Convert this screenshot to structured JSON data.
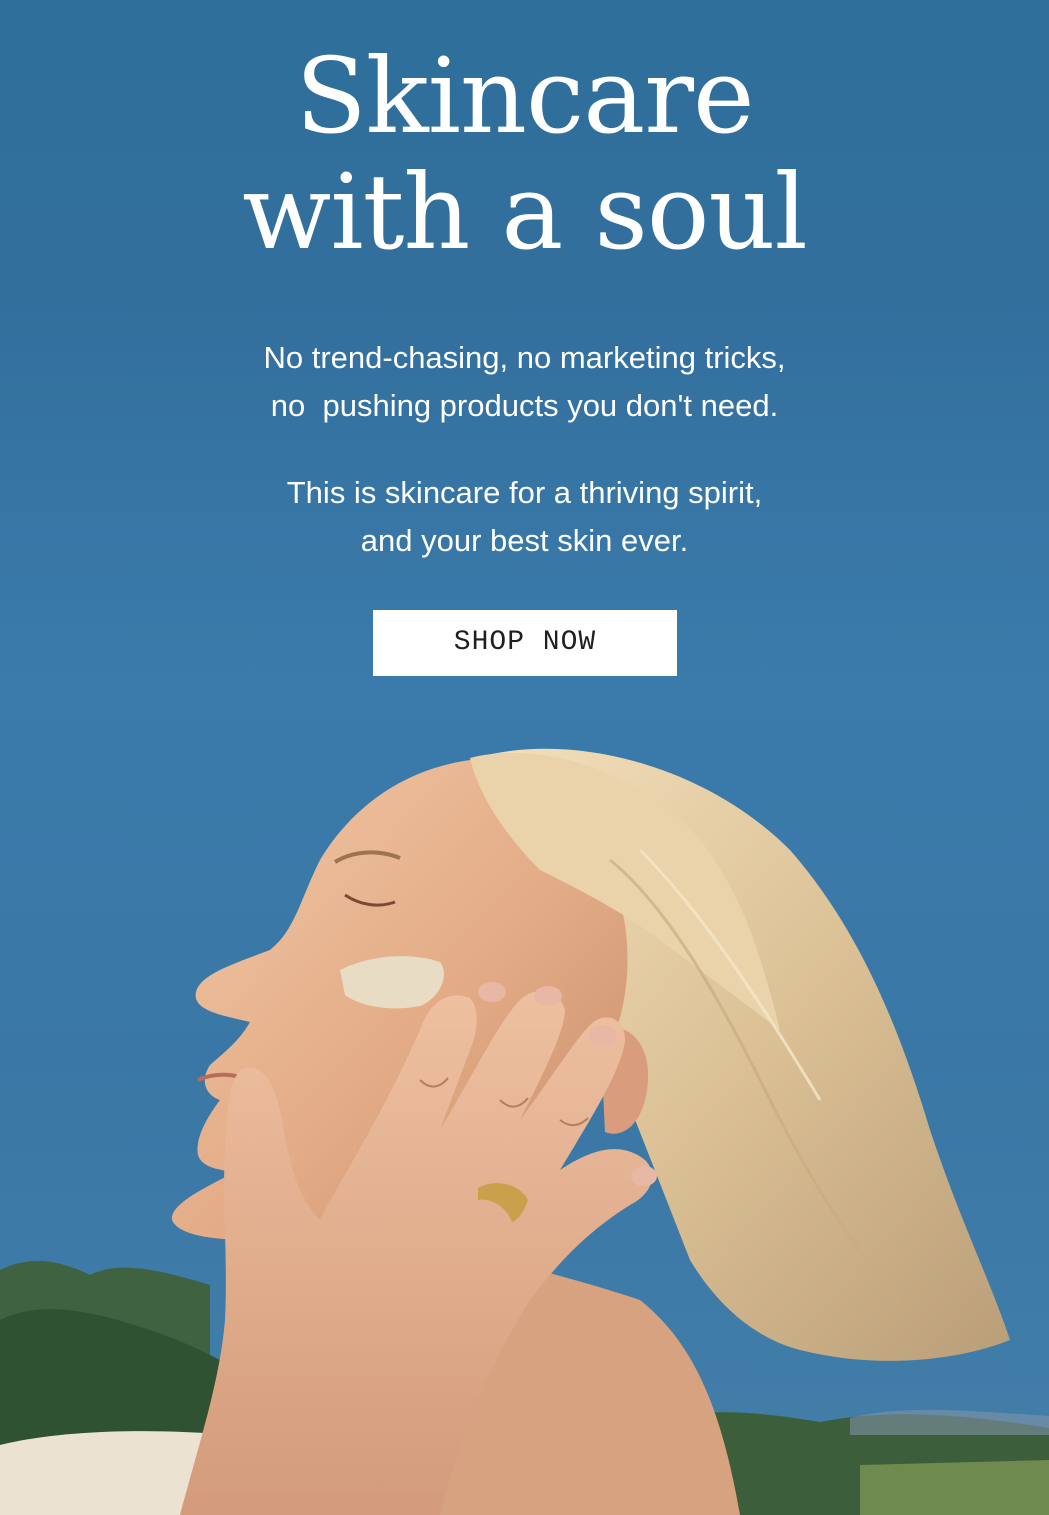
{
  "hero": {
    "headline_line1": "Skincare",
    "headline_line2": "with a soul",
    "intro_line1": "No trend-chasing, no marketing tricks,",
    "intro_line2": "no  pushing products you don't need.",
    "tagline_line1": "This is skincare for a thriving spirit,",
    "tagline_line2": "and your best skin ever.",
    "cta_label": "SHOP NOW"
  },
  "colors": {
    "sky_blue": "#3a7bab",
    "text": "#ffffff",
    "button_bg": "#ffffff",
    "button_text": "#1f1f1f"
  }
}
